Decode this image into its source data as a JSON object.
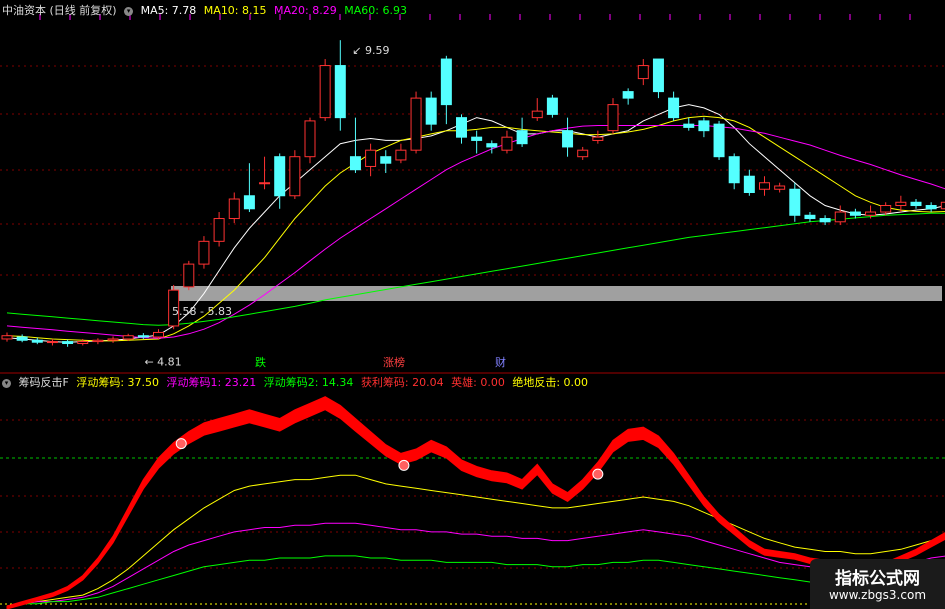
{
  "header": {
    "title": "中油资本 (日线 前复权)",
    "ma5": "MA5: 7.78",
    "ma10": "MA10: 8.15",
    "ma20": "MA20: 8.29",
    "ma60": "MA60: 6.93"
  },
  "indicator": {
    "name": "筹码反击F",
    "v1": "浮动筹码: 37.50",
    "v2": "浮动筹码1: 23.21",
    "v3": "浮动筹码2: 14.34",
    "v4": "获利筹码: 20.04",
    "v5": "英雄: 0.00",
    "v6": "绝地反击: 0.00"
  },
  "signals": {
    "s1": "跌",
    "s2": "涨榜",
    "s3": "财"
  },
  "watermark": {
    "line1": "指标公式网",
    "line2": "www.zbgs3.com"
  },
  "colors": {
    "up": "#ff3232",
    "down": "#54ffff",
    "ma5": "#ffffff",
    "ma10": "#ffff00",
    "ma20": "#ff00ff",
    "ma60": "#00ff00",
    "band": "#ff0000",
    "gray": "#a0a0a0"
  },
  "chart_data": [
    {
      "type": "candlestick",
      "title": "中油资本 (日线 前复权)",
      "ylim": [
        4.6,
        9.9
      ],
      "annotations": [
        {
          "label": "9.59",
          "y": 9.59
        },
        {
          "label": "4.81",
          "y": 4.81
        },
        {
          "label": "5.58 - 5.83",
          "y": 5.7
        }
      ],
      "candles": [
        [
          5.0,
          5.05,
          4.96,
          5.1
        ],
        [
          5.03,
          4.98,
          4.95,
          5.07
        ],
        [
          4.98,
          4.95,
          4.92,
          5.02
        ],
        [
          4.95,
          4.96,
          4.9,
          5.0
        ],
        [
          4.96,
          4.93,
          4.88,
          4.99
        ],
        [
          4.93,
          4.96,
          4.9,
          5.0
        ],
        [
          4.96,
          4.98,
          4.92,
          5.01
        ],
        [
          4.98,
          5.0,
          4.94,
          5.04
        ],
        [
          5.0,
          5.05,
          4.97,
          5.08
        ],
        [
          5.05,
          5.03,
          5.0,
          5.09
        ],
        [
          5.03,
          5.1,
          5.0,
          5.15
        ],
        [
          5.2,
          5.75,
          5.15,
          5.83
        ],
        [
          5.8,
          6.15,
          5.75,
          6.2
        ],
        [
          6.15,
          6.5,
          6.08,
          6.58
        ],
        [
          6.5,
          6.85,
          6.42,
          6.95
        ],
        [
          6.85,
          7.15,
          6.78,
          7.25
        ],
        [
          7.2,
          7.0,
          6.95,
          7.7
        ],
        [
          7.4,
          7.4,
          7.3,
          7.8
        ],
        [
          7.8,
          7.2,
          7.0,
          7.85
        ],
        [
          7.2,
          7.8,
          7.15,
          7.9
        ],
        [
          7.8,
          8.35,
          7.7,
          8.4
        ],
        [
          8.4,
          9.2,
          8.35,
          9.3
        ],
        [
          9.2,
          8.4,
          8.2,
          9.59
        ],
        [
          7.8,
          7.6,
          7.55,
          8.4
        ],
        [
          7.65,
          7.9,
          7.5,
          8.0
        ],
        [
          7.8,
          7.7,
          7.55,
          7.9
        ],
        [
          7.75,
          7.9,
          7.7,
          8.0
        ],
        [
          7.9,
          8.7,
          7.85,
          8.8
        ],
        [
          8.7,
          8.3,
          8.2,
          8.8
        ],
        [
          9.3,
          8.6,
          8.3,
          9.35
        ],
        [
          8.4,
          8.1,
          8.0,
          8.45
        ],
        [
          8.1,
          8.05,
          7.85,
          8.2
        ],
        [
          8.0,
          7.95,
          7.85,
          8.05
        ],
        [
          7.9,
          8.1,
          7.85,
          8.2
        ],
        [
          8.2,
          8.0,
          7.95,
          8.4
        ],
        [
          8.4,
          8.5,
          8.35,
          8.7
        ],
        [
          8.7,
          8.45,
          8.4,
          8.75
        ],
        [
          8.2,
          7.95,
          7.8,
          8.4
        ],
        [
          7.8,
          7.9,
          7.75,
          7.95
        ],
        [
          8.05,
          8.1,
          8.0,
          8.2
        ],
        [
          8.2,
          8.6,
          8.15,
          8.7
        ],
        [
          8.8,
          8.7,
          8.6,
          8.85
        ],
        [
          9.0,
          9.2,
          8.9,
          9.3
        ],
        [
          9.3,
          8.8,
          8.7,
          9.3
        ],
        [
          8.7,
          8.4,
          8.35,
          8.8
        ],
        [
          8.3,
          8.25,
          8.2,
          8.4
        ],
        [
          8.35,
          8.2,
          8.1,
          8.4
        ],
        [
          8.3,
          7.8,
          7.75,
          8.35
        ],
        [
          7.8,
          7.4,
          7.3,
          7.85
        ],
        [
          7.5,
          7.25,
          7.2,
          7.6
        ],
        [
          7.3,
          7.4,
          7.2,
          7.5
        ],
        [
          7.3,
          7.35,
          7.25,
          7.4
        ],
        [
          7.3,
          6.9,
          6.8,
          7.4
        ],
        [
          6.9,
          6.85,
          6.8,
          6.95
        ],
        [
          6.85,
          6.8,
          6.75,
          6.9
        ],
        [
          6.8,
          6.95,
          6.75,
          7.05
        ],
        [
          6.95,
          6.9,
          6.85,
          7.0
        ],
        [
          6.9,
          6.95,
          6.85,
          7.05
        ],
        [
          6.95,
          7.05,
          6.9,
          7.1
        ],
        [
          7.05,
          7.1,
          6.95,
          7.2
        ],
        [
          7.1,
          7.05,
          7.0,
          7.15
        ],
        [
          7.05,
          7.0,
          6.95,
          7.1
        ],
        [
          7.0,
          7.1,
          6.95,
          7.15
        ]
      ],
      "series": [
        {
          "name": "MA5",
          "values": [
            5.02,
            5.0,
            4.98,
            4.96,
            4.95,
            4.96,
            4.97,
            4.98,
            5.0,
            5.03,
            5.06,
            5.2,
            5.4,
            5.7,
            6.05,
            6.4,
            6.7,
            6.95,
            7.2,
            7.4,
            7.6,
            7.8,
            8.0,
            8.05,
            8.08,
            8.05,
            8.05,
            8.08,
            8.12,
            8.2,
            8.3,
            8.4,
            8.35,
            8.25,
            8.15,
            8.15,
            8.2,
            8.2,
            8.15,
            8.1,
            8.15,
            8.2,
            8.35,
            8.45,
            8.55,
            8.6,
            8.55,
            8.45,
            8.25,
            8.0,
            7.8,
            7.6,
            7.4,
            7.2,
            7.05,
            6.98,
            6.92,
            6.9,
            6.92,
            6.95,
            6.98,
            7.0,
            7.05
          ]
        },
        {
          "name": "MA10",
          "values": [
            5.05,
            5.04,
            5.02,
            5.0,
            4.99,
            4.98,
            4.97,
            4.97,
            4.98,
            4.99,
            5.0,
            5.08,
            5.2,
            5.35,
            5.55,
            5.75,
            6.0,
            6.25,
            6.55,
            6.85,
            7.1,
            7.35,
            7.55,
            7.7,
            7.85,
            7.95,
            8.05,
            8.1,
            8.15,
            8.2,
            8.2,
            8.22,
            8.25,
            8.25,
            8.22,
            8.2,
            8.18,
            8.16,
            8.14,
            8.14,
            8.15,
            8.18,
            8.22,
            8.28,
            8.35,
            8.4,
            8.42,
            8.4,
            8.35,
            8.25,
            8.1,
            7.95,
            7.8,
            7.65,
            7.5,
            7.35,
            7.2,
            7.1,
            7.02,
            6.98,
            6.96,
            6.95,
            6.96
          ]
        },
        {
          "name": "MA20",
          "values": [
            5.2,
            5.18,
            5.16,
            5.14,
            5.12,
            5.1,
            5.08,
            5.06,
            5.04,
            5.02,
            5.01,
            5.03,
            5.08,
            5.15,
            5.25,
            5.38,
            5.52,
            5.68,
            5.85,
            6.02,
            6.2,
            6.38,
            6.55,
            6.7,
            6.85,
            7.0,
            7.15,
            7.3,
            7.45,
            7.6,
            7.72,
            7.82,
            7.92,
            8.0,
            8.08,
            8.15,
            8.2,
            8.24,
            8.27,
            8.28,
            8.28,
            8.28,
            8.28,
            8.28,
            8.28,
            8.28,
            8.28,
            8.26,
            8.24,
            8.2,
            8.16,
            8.1,
            8.04,
            7.98,
            7.9,
            7.82,
            7.75,
            7.68,
            7.6,
            7.52,
            7.45,
            7.38,
            7.3
          ]
        },
        {
          "name": "MA60",
          "values": [
            5.4,
            5.38,
            5.36,
            5.34,
            5.32,
            5.3,
            5.28,
            5.26,
            5.24,
            5.22,
            5.21,
            5.22,
            5.24,
            5.27,
            5.3,
            5.34,
            5.38,
            5.42,
            5.46,
            5.5,
            5.55,
            5.6,
            5.64,
            5.68,
            5.72,
            5.76,
            5.8,
            5.84,
            5.88,
            5.92,
            5.96,
            6.0,
            6.04,
            6.08,
            6.12,
            6.16,
            6.2,
            6.24,
            6.28,
            6.32,
            6.36,
            6.4,
            6.44,
            6.48,
            6.52,
            6.56,
            6.59,
            6.62,
            6.65,
            6.68,
            6.71,
            6.74,
            6.77,
            6.8,
            6.82,
            6.84,
            6.86,
            6.88,
            6.9,
            6.91,
            6.92,
            6.93,
            6.93
          ]
        }
      ]
    },
    {
      "type": "line",
      "title": "筹码反击F",
      "ylim": [
        0,
        100
      ],
      "series": [
        {
          "name": "浮动筹码",
          "values": [
            0,
            1,
            2,
            3,
            4,
            5,
            8,
            12,
            17,
            23,
            29,
            35,
            40,
            45,
            49,
            53,
            55,
            56,
            57,
            58,
            58,
            59,
            60,
            60,
            58,
            56,
            55,
            54,
            53,
            52,
            51,
            50,
            49,
            48,
            47,
            46,
            45,
            45,
            46,
            47,
            48,
            49,
            50,
            49,
            48,
            46,
            43,
            40,
            37,
            34,
            31,
            29,
            27,
            26,
            25,
            25,
            24,
            24,
            25,
            26,
            28,
            30,
            31
          ]
        },
        {
          "name": "浮动筹码1",
          "values": [
            0,
            1,
            2,
            2,
            3,
            4,
            6,
            9,
            13,
            17,
            21,
            25,
            28,
            30,
            32,
            34,
            35,
            36,
            36,
            37,
            37,
            38,
            38,
            38,
            37,
            36,
            35,
            35,
            34,
            34,
            33,
            33,
            32,
            32,
            31,
            31,
            30,
            30,
            31,
            32,
            33,
            34,
            35,
            34,
            33,
            32,
            30,
            28,
            26,
            24,
            22,
            20,
            19,
            18,
            17,
            17,
            17,
            17,
            18,
            19,
            20,
            22,
            23
          ]
        },
        {
          "name": "浮动筹码2",
          "values": [
            0,
            1,
            1,
            2,
            2,
            3,
            4,
            6,
            8,
            10,
            12,
            14,
            16,
            18,
            19,
            20,
            21,
            21,
            22,
            22,
            22,
            23,
            23,
            23,
            22,
            22,
            21,
            21,
            21,
            20,
            20,
            20,
            20,
            19,
            19,
            19,
            18,
            18,
            19,
            19,
            20,
            20,
            21,
            21,
            20,
            19,
            18,
            17,
            16,
            15,
            14,
            13,
            12,
            11,
            10,
            10,
            10,
            10,
            11,
            11,
            12,
            13,
            14
          ]
        },
        {
          "name": "获利筹码",
          "values": [
            0,
            2,
            4,
            6,
            9,
            14,
            22,
            32,
            45,
            58,
            68,
            75,
            80,
            84,
            86,
            88,
            90,
            88,
            86,
            90,
            93,
            96,
            92,
            86,
            80,
            74,
            70,
            72,
            76,
            73,
            67,
            64,
            62,
            61,
            58,
            65,
            56,
            52,
            58,
            66,
            76,
            81,
            82,
            78,
            70,
            60,
            50,
            42,
            36,
            30,
            26,
            25,
            24,
            22,
            21,
            20,
            20,
            19,
            20,
            23,
            26,
            30,
            34
          ]
        }
      ]
    }
  ]
}
